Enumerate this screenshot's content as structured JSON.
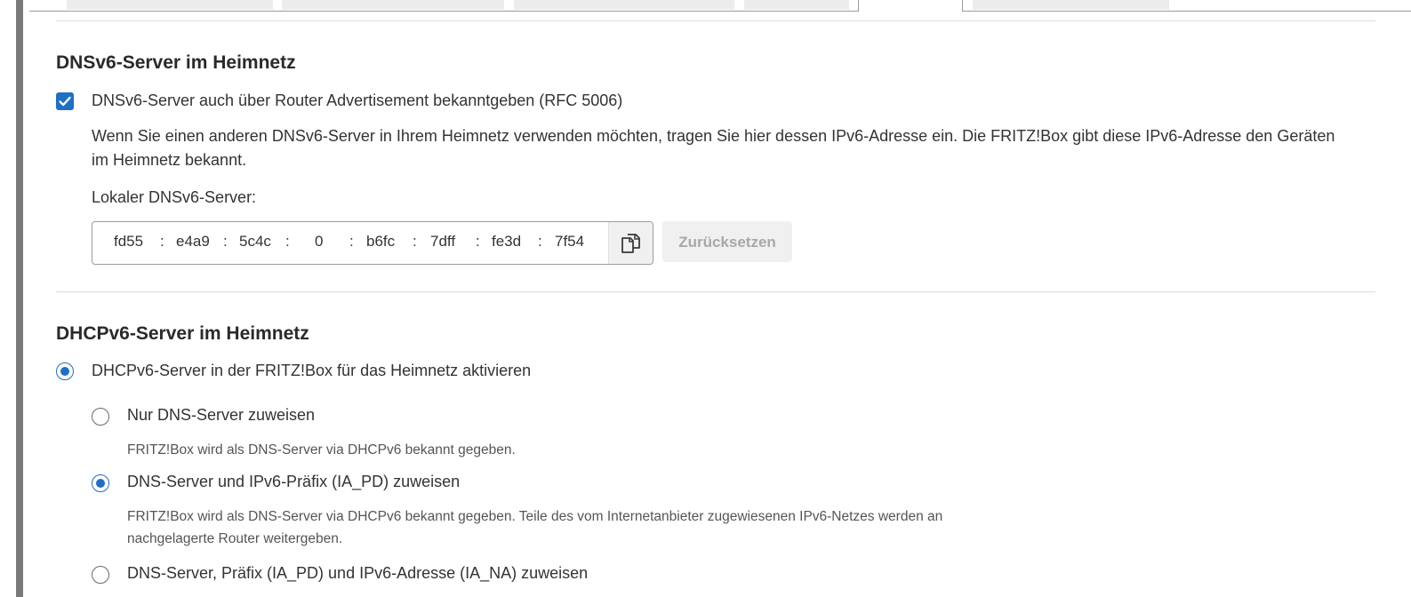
{
  "dnsv6": {
    "title": "DNSv6-Server im Heimnetz",
    "checkbox_label": "DNSv6-Server auch über Router Advertisement bekanntgeben (RFC 5006)",
    "checkbox_checked": true,
    "description": "Wenn Sie einen anderen DNSv6-Server in Ihrem Heimnetz verwenden möchten, tragen Sie hier dessen IPv6-Adresse ein. Die FRITZ!Box gibt diese IPv6-Adresse den Geräten im Heimnetz bekannt.",
    "local_server_label": "Lokaler DNSv6-Server:",
    "ipv6_segments": [
      "fd55",
      "e4a9",
      "5c4c",
      "0",
      "b6fc",
      "7dff",
      "fe3d",
      "7f54"
    ],
    "copy_icon": "copy-icon",
    "reset_label": "Zurücksetzen"
  },
  "dhcpv6": {
    "title": "DHCPv6-Server im Heimnetz",
    "enable_label": "DHCPv6-Server in der FRITZ!Box für das Heimnetz aktivieren",
    "enable_checked": true,
    "options": [
      {
        "label": "Nur DNS-Server zuweisen",
        "hint": "FRITZ!Box wird als DNS-Server via DHCPv6 bekannt gegeben.",
        "checked": false
      },
      {
        "label": "DNS-Server und IPv6-Präfix (IA_PD) zuweisen",
        "hint": "FRITZ!Box wird als DNS-Server via DHCPv6 bekannt gegeben. Teile des vom Internetanbieter zugewiesenen IPv6-Netzes werden an nachgelagerte Router weitergeben.",
        "checked": true
      },
      {
        "label": "DNS-Server, Präfix (IA_PD) und IPv6-Adresse (IA_NA) zuweisen",
        "hint": "",
        "checked": false
      }
    ]
  },
  "colors": {
    "accent": "#1f6fc5",
    "button_disabled_text": "#a8a8a8",
    "divider": "#dcdcdc"
  }
}
